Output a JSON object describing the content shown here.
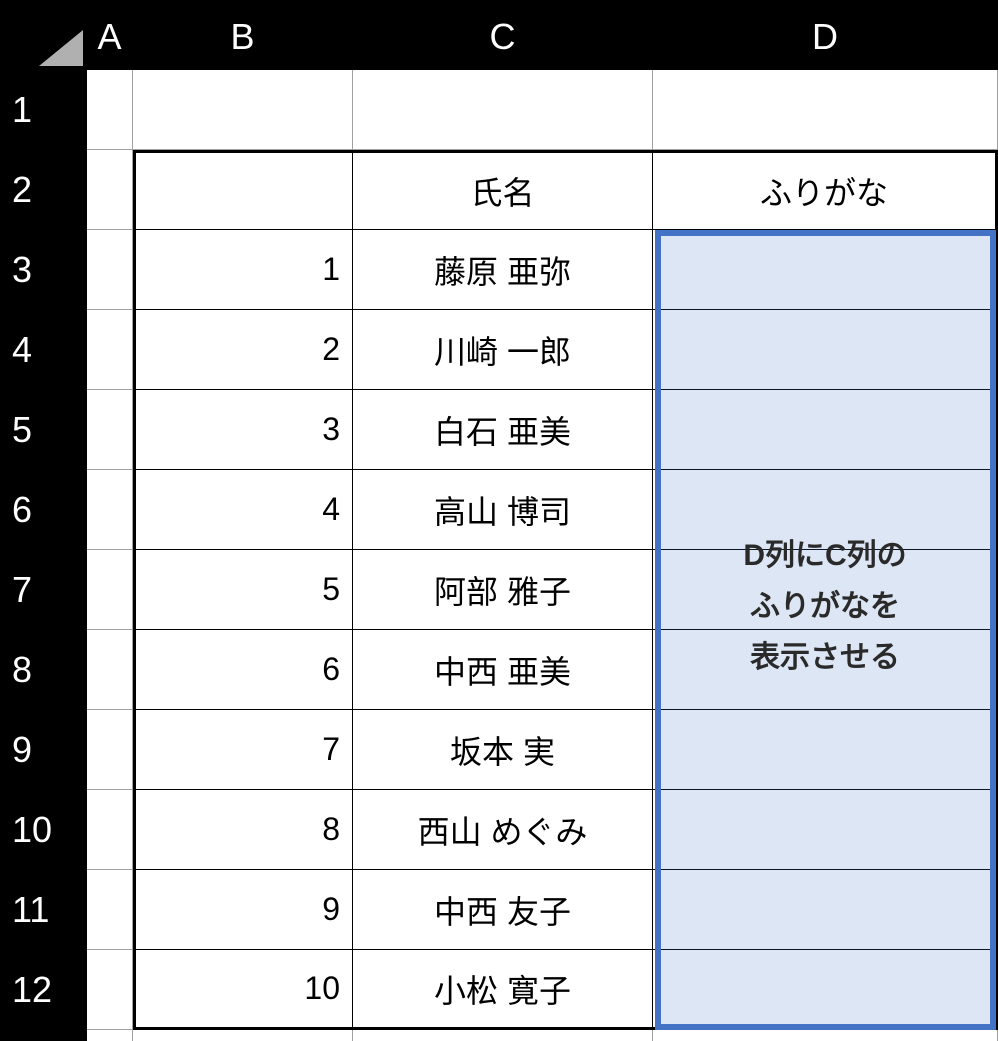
{
  "columns": [
    "A",
    "B",
    "C",
    "D"
  ],
  "rowNumbers": [
    "1",
    "2",
    "3",
    "4",
    "5",
    "6",
    "7",
    "8",
    "9",
    "10",
    "11",
    "12"
  ],
  "headerRow": {
    "B": "",
    "C": "氏名",
    "D": "ふりがな"
  },
  "dataRows": [
    {
      "num": "1",
      "name": "藤原  亜弥"
    },
    {
      "num": "2",
      "name": "川崎  一郎"
    },
    {
      "num": "3",
      "name": "白石  亜美"
    },
    {
      "num": "4",
      "name": "高山  博司"
    },
    {
      "num": "5",
      "name": "阿部  雅子"
    },
    {
      "num": "6",
      "name": "中西  亜美"
    },
    {
      "num": "7",
      "name": "坂本  実"
    },
    {
      "num": "8",
      "name": "西山  めぐみ"
    },
    {
      "num": "9",
      "name": "中西  友子"
    },
    {
      "num": "10",
      "name": "小松  寛子"
    }
  ],
  "annotation": {
    "line1": "D列にC列の",
    "line2": "ふりがなを",
    "line3": "表示させる"
  },
  "selection": {
    "range": "D3:D12"
  }
}
